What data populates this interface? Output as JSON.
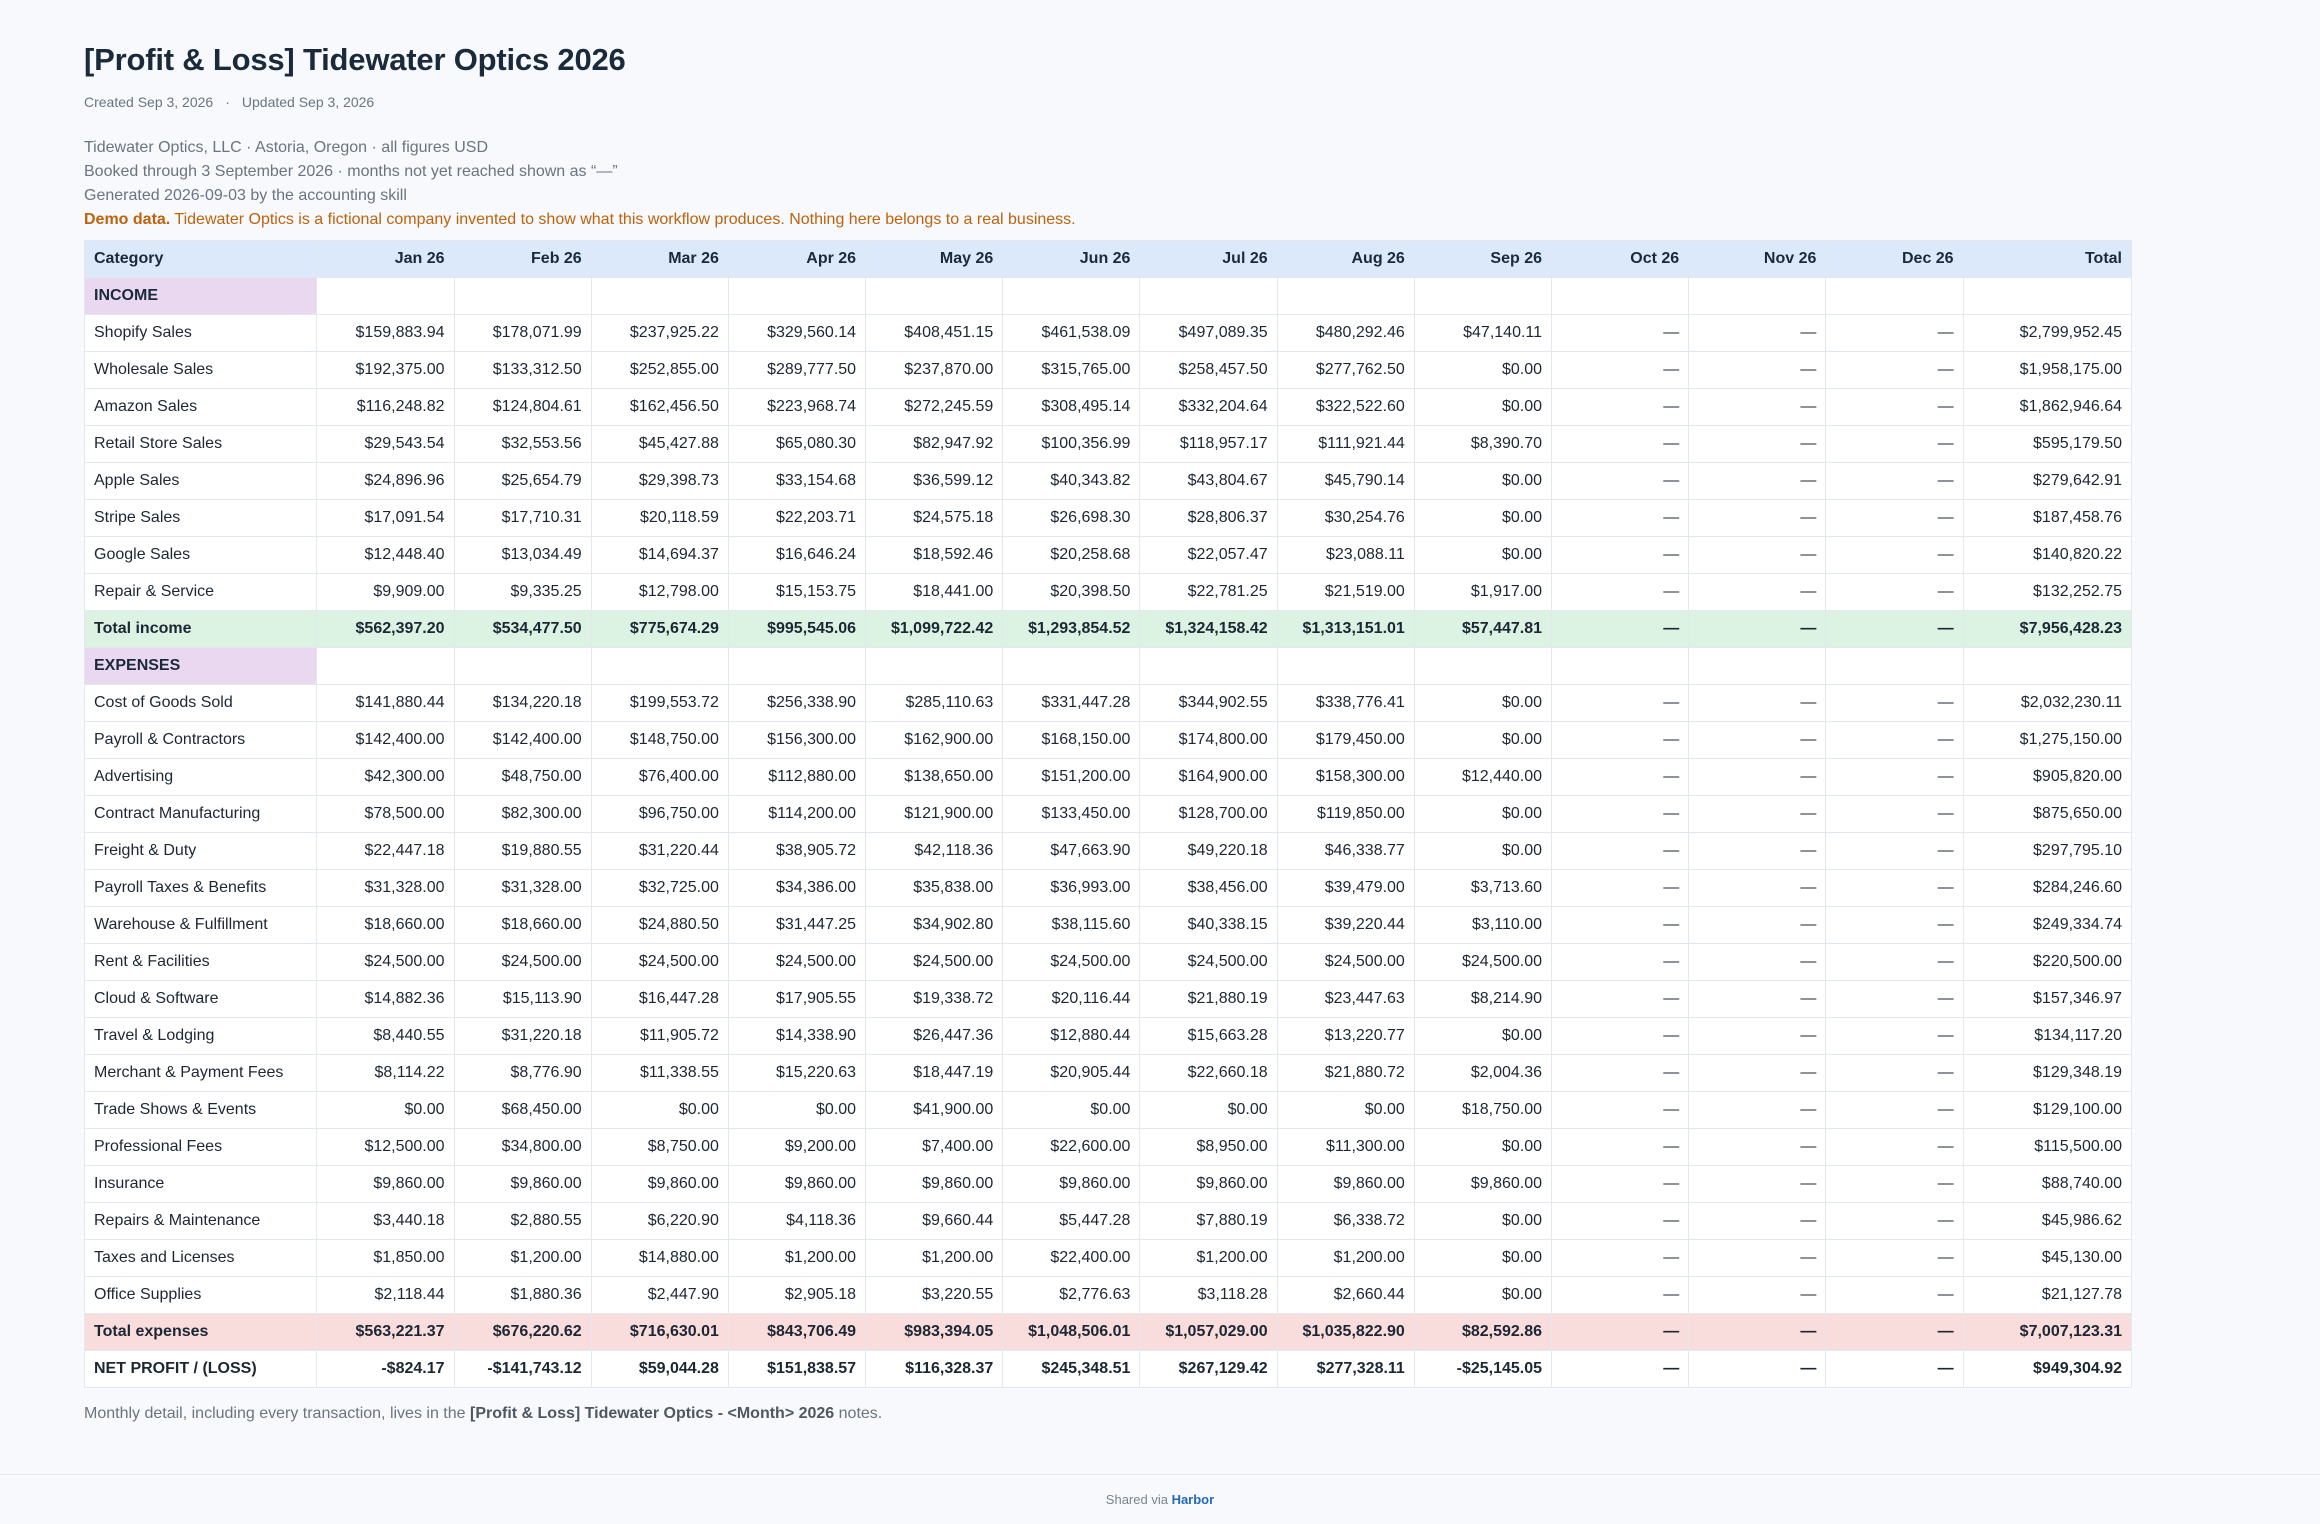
{
  "doc": {
    "title": "[Profit & Loss] Tidewater Optics 2026",
    "created": "Created Sep 3, 2026",
    "separator": "·",
    "updated": "Updated Sep 3, 2026",
    "intro": {
      "line1": "Tidewater Optics, LLC · Astoria, Oregon · all figures USD",
      "line2": "Booked through 3 September 2026 · months not yet reached shown as “—”",
      "line3": "Generated 2026-09-03 by the accounting skill",
      "demo_label": "Demo data.",
      "demo_text": " Tidewater Optics is a fictional company invented to show what this workflow produces. Nothing here belongs to a real business."
    },
    "footnote": {
      "before": "Monthly detail, including every transaction, lives in the ",
      "bold": "[Profit & Loss] Tidewater Optics - <Month> 2026",
      "after": " notes."
    }
  },
  "table": {
    "headers": [
      "Category",
      "Jan 26",
      "Feb 26",
      "Mar 26",
      "Apr 26",
      "May 26",
      "Jun 26",
      "Jul 26",
      "Aug 26",
      "Sep 26",
      "Oct 26",
      "Nov 26",
      "Dec 26",
      "Total"
    ],
    "income_label": "INCOME",
    "income_rows": [
      [
        "Shopify Sales",
        "$159,883.94",
        "$178,071.99",
        "$237,925.22",
        "$329,560.14",
        "$408,451.15",
        "$461,538.09",
        "$497,089.35",
        "$480,292.46",
        "$47,140.11",
        "—",
        "—",
        "—",
        "$2,799,952.45"
      ],
      [
        "Wholesale Sales",
        "$192,375.00",
        "$133,312.50",
        "$252,855.00",
        "$289,777.50",
        "$237,870.00",
        "$315,765.00",
        "$258,457.50",
        "$277,762.50",
        "$0.00",
        "—",
        "—",
        "—",
        "$1,958,175.00"
      ],
      [
        "Amazon Sales",
        "$116,248.82",
        "$124,804.61",
        "$162,456.50",
        "$223,968.74",
        "$272,245.59",
        "$308,495.14",
        "$332,204.64",
        "$322,522.60",
        "$0.00",
        "—",
        "—",
        "—",
        "$1,862,946.64"
      ],
      [
        "Retail Store Sales",
        "$29,543.54",
        "$32,553.56",
        "$45,427.88",
        "$65,080.30",
        "$82,947.92",
        "$100,356.99",
        "$118,957.17",
        "$111,921.44",
        "$8,390.70",
        "—",
        "—",
        "—",
        "$595,179.50"
      ],
      [
        "Apple Sales",
        "$24,896.96",
        "$25,654.79",
        "$29,398.73",
        "$33,154.68",
        "$36,599.12",
        "$40,343.82",
        "$43,804.67",
        "$45,790.14",
        "$0.00",
        "—",
        "—",
        "—",
        "$279,642.91"
      ],
      [
        "Stripe Sales",
        "$17,091.54",
        "$17,710.31",
        "$20,118.59",
        "$22,203.71",
        "$24,575.18",
        "$26,698.30",
        "$28,806.37",
        "$30,254.76",
        "$0.00",
        "—",
        "—",
        "—",
        "$187,458.76"
      ],
      [
        "Google Sales",
        "$12,448.40",
        "$13,034.49",
        "$14,694.37",
        "$16,646.24",
        "$18,592.46",
        "$20,258.68",
        "$22,057.47",
        "$23,088.11",
        "$0.00",
        "—",
        "—",
        "—",
        "$140,820.22"
      ],
      [
        "Repair & Service",
        "$9,909.00",
        "$9,335.25",
        "$12,798.00",
        "$15,153.75",
        "$18,441.00",
        "$20,398.50",
        "$22,781.25",
        "$21,519.00",
        "$1,917.00",
        "—",
        "—",
        "—",
        "$132,252.75"
      ]
    ],
    "total_income": [
      "Total income",
      "$562,397.20",
      "$534,477.50",
      "$775,674.29",
      "$995,545.06",
      "$1,099,722.42",
      "$1,293,854.52",
      "$1,324,158.42",
      "$1,313,151.01",
      "$57,447.81",
      "—",
      "—",
      "—",
      "$7,956,428.23"
    ],
    "expenses_label": "EXPENSES",
    "expense_rows": [
      [
        "Cost of Goods Sold",
        "$141,880.44",
        "$134,220.18",
        "$199,553.72",
        "$256,338.90",
        "$285,110.63",
        "$331,447.28",
        "$344,902.55",
        "$338,776.41",
        "$0.00",
        "—",
        "—",
        "—",
        "$2,032,230.11"
      ],
      [
        "Payroll & Contractors",
        "$142,400.00",
        "$142,400.00",
        "$148,750.00",
        "$156,300.00",
        "$162,900.00",
        "$168,150.00",
        "$174,800.00",
        "$179,450.00",
        "$0.00",
        "—",
        "—",
        "—",
        "$1,275,150.00"
      ],
      [
        "Advertising",
        "$42,300.00",
        "$48,750.00",
        "$76,400.00",
        "$112,880.00",
        "$138,650.00",
        "$151,200.00",
        "$164,900.00",
        "$158,300.00",
        "$12,440.00",
        "—",
        "—",
        "—",
        "$905,820.00"
      ],
      [
        "Contract Manufacturing",
        "$78,500.00",
        "$82,300.00",
        "$96,750.00",
        "$114,200.00",
        "$121,900.00",
        "$133,450.00",
        "$128,700.00",
        "$119,850.00",
        "$0.00",
        "—",
        "—",
        "—",
        "$875,650.00"
      ],
      [
        "Freight & Duty",
        "$22,447.18",
        "$19,880.55",
        "$31,220.44",
        "$38,905.72",
        "$42,118.36",
        "$47,663.90",
        "$49,220.18",
        "$46,338.77",
        "$0.00",
        "—",
        "—",
        "—",
        "$297,795.10"
      ],
      [
        "Payroll Taxes & Benefits",
        "$31,328.00",
        "$31,328.00",
        "$32,725.00",
        "$34,386.00",
        "$35,838.00",
        "$36,993.00",
        "$38,456.00",
        "$39,479.00",
        "$3,713.60",
        "—",
        "—",
        "—",
        "$284,246.60"
      ],
      [
        "Warehouse & Fulfillment",
        "$18,660.00",
        "$18,660.00",
        "$24,880.50",
        "$31,447.25",
        "$34,902.80",
        "$38,115.60",
        "$40,338.15",
        "$39,220.44",
        "$3,110.00",
        "—",
        "—",
        "—",
        "$249,334.74"
      ],
      [
        "Rent & Facilities",
        "$24,500.00",
        "$24,500.00",
        "$24,500.00",
        "$24,500.00",
        "$24,500.00",
        "$24,500.00",
        "$24,500.00",
        "$24,500.00",
        "$24,500.00",
        "—",
        "—",
        "—",
        "$220,500.00"
      ],
      [
        "Cloud & Software",
        "$14,882.36",
        "$15,113.90",
        "$16,447.28",
        "$17,905.55",
        "$19,338.72",
        "$20,116.44",
        "$21,880.19",
        "$23,447.63",
        "$8,214.90",
        "—",
        "—",
        "—",
        "$157,346.97"
      ],
      [
        "Travel & Lodging",
        "$8,440.55",
        "$31,220.18",
        "$11,905.72",
        "$14,338.90",
        "$26,447.36",
        "$12,880.44",
        "$15,663.28",
        "$13,220.77",
        "$0.00",
        "—",
        "—",
        "—",
        "$134,117.20"
      ],
      [
        "Merchant & Payment Fees",
        "$8,114.22",
        "$8,776.90",
        "$11,338.55",
        "$15,220.63",
        "$18,447.19",
        "$20,905.44",
        "$22,660.18",
        "$21,880.72",
        "$2,004.36",
        "—",
        "—",
        "—",
        "$129,348.19"
      ],
      [
        "Trade Shows & Events",
        "$0.00",
        "$68,450.00",
        "$0.00",
        "$0.00",
        "$41,900.00",
        "$0.00",
        "$0.00",
        "$0.00",
        "$18,750.00",
        "—",
        "—",
        "—",
        "$129,100.00"
      ],
      [
        "Professional Fees",
        "$12,500.00",
        "$34,800.00",
        "$8,750.00",
        "$9,200.00",
        "$7,400.00",
        "$22,600.00",
        "$8,950.00",
        "$11,300.00",
        "$0.00",
        "—",
        "—",
        "—",
        "$115,500.00"
      ],
      [
        "Insurance",
        "$9,860.00",
        "$9,860.00",
        "$9,860.00",
        "$9,860.00",
        "$9,860.00",
        "$9,860.00",
        "$9,860.00",
        "$9,860.00",
        "$9,860.00",
        "—",
        "—",
        "—",
        "$88,740.00"
      ],
      [
        "Repairs & Maintenance",
        "$3,440.18",
        "$2,880.55",
        "$6,220.90",
        "$4,118.36",
        "$9,660.44",
        "$5,447.28",
        "$7,880.19",
        "$6,338.72",
        "$0.00",
        "—",
        "—",
        "—",
        "$45,986.62"
      ],
      [
        "Taxes and Licenses",
        "$1,850.00",
        "$1,200.00",
        "$14,880.00",
        "$1,200.00",
        "$1,200.00",
        "$22,400.00",
        "$1,200.00",
        "$1,200.00",
        "$0.00",
        "—",
        "—",
        "—",
        "$45,130.00"
      ],
      [
        "Office Supplies",
        "$2,118.44",
        "$1,880.36",
        "$2,447.90",
        "$2,905.18",
        "$3,220.55",
        "$2,776.63",
        "$3,118.28",
        "$2,660.44",
        "$0.00",
        "—",
        "—",
        "—",
        "$21,127.78"
      ]
    ],
    "total_expenses": [
      "Total expenses",
      "$563,221.37",
      "$676,220.62",
      "$716,630.01",
      "$843,706.49",
      "$983,394.05",
      "$1,048,506.01",
      "$1,057,029.00",
      "$1,035,822.90",
      "$82,592.86",
      "—",
      "—",
      "—",
      "$7,007,123.31"
    ],
    "net_profit": [
      "NET PROFIT / (LOSS)",
      "-$824.17",
      "-$141,743.12",
      "$59,044.28",
      "$151,838.57",
      "$116,328.37",
      "$245,348.51",
      "$267,129.42",
      "$277,328.11",
      "-$25,145.05",
      "—",
      "—",
      "—",
      "$949,304.92"
    ]
  },
  "footer": {
    "prefix": "Shared via ",
    "brand": "Harbor"
  }
}
